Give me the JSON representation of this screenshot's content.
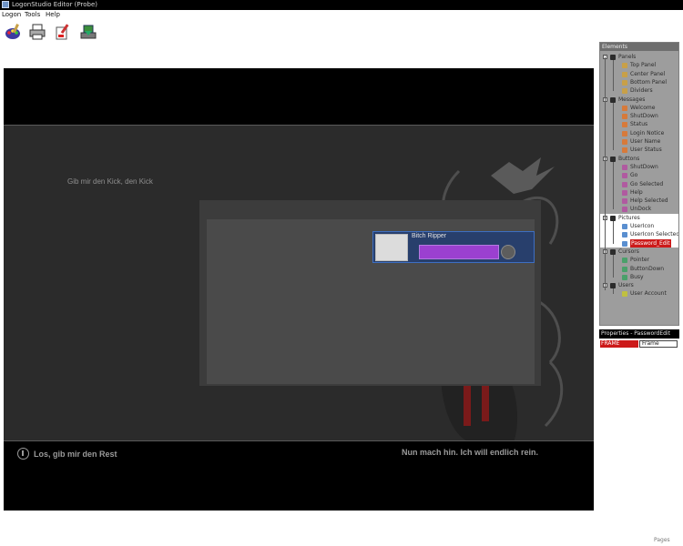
{
  "window": {
    "title": "LogonStudio Editor (Probe)"
  },
  "menu": {
    "items": [
      "Logon",
      "Tools",
      "Help"
    ]
  },
  "toolbar": {
    "buttons": [
      "palette-icon",
      "printer-icon",
      "brush-icon",
      "install-icon"
    ]
  },
  "preview": {
    "welcome_text": "Gib mir den Kick, den Kick",
    "user_name": "Bitch Ripper",
    "shutdown_text": "Los, gib mir den Rest",
    "notice_text": "Nun mach hin. Ich will endlich rein.",
    "password_color": "#9b40d0"
  },
  "elements_panel": {
    "header": "Elements",
    "groups": [
      {
        "label": "Panels",
        "items": [
          "Top Panel",
          "Center Panel",
          "Bottom Panel",
          "Dividers"
        ]
      },
      {
        "label": "Messages",
        "items": [
          "Welcome",
          "ShutDown",
          "Status",
          "Login Notice",
          "User Name",
          "User Status"
        ]
      },
      {
        "label": "Buttons",
        "items": [
          "ShutDown",
          "Go",
          "Go Selected",
          "Help",
          "Help Selected",
          "UnDock"
        ]
      },
      {
        "label": "Pictures",
        "items": [
          "UserIcon",
          "UserIcon Selected",
          "Password_Edit"
        ]
      },
      {
        "label": "Cursors",
        "items": [
          "Pointer",
          "ButtonDown",
          "Busy"
        ]
      },
      {
        "label": "Users",
        "items": [
          "User Account"
        ]
      }
    ],
    "selected_item": "Password_Edit"
  },
  "properties_panel": {
    "title": "Properties - PasswordEdit",
    "key": "FRAME",
    "value": "Frame"
  },
  "status": {
    "right_text": "Pages"
  }
}
